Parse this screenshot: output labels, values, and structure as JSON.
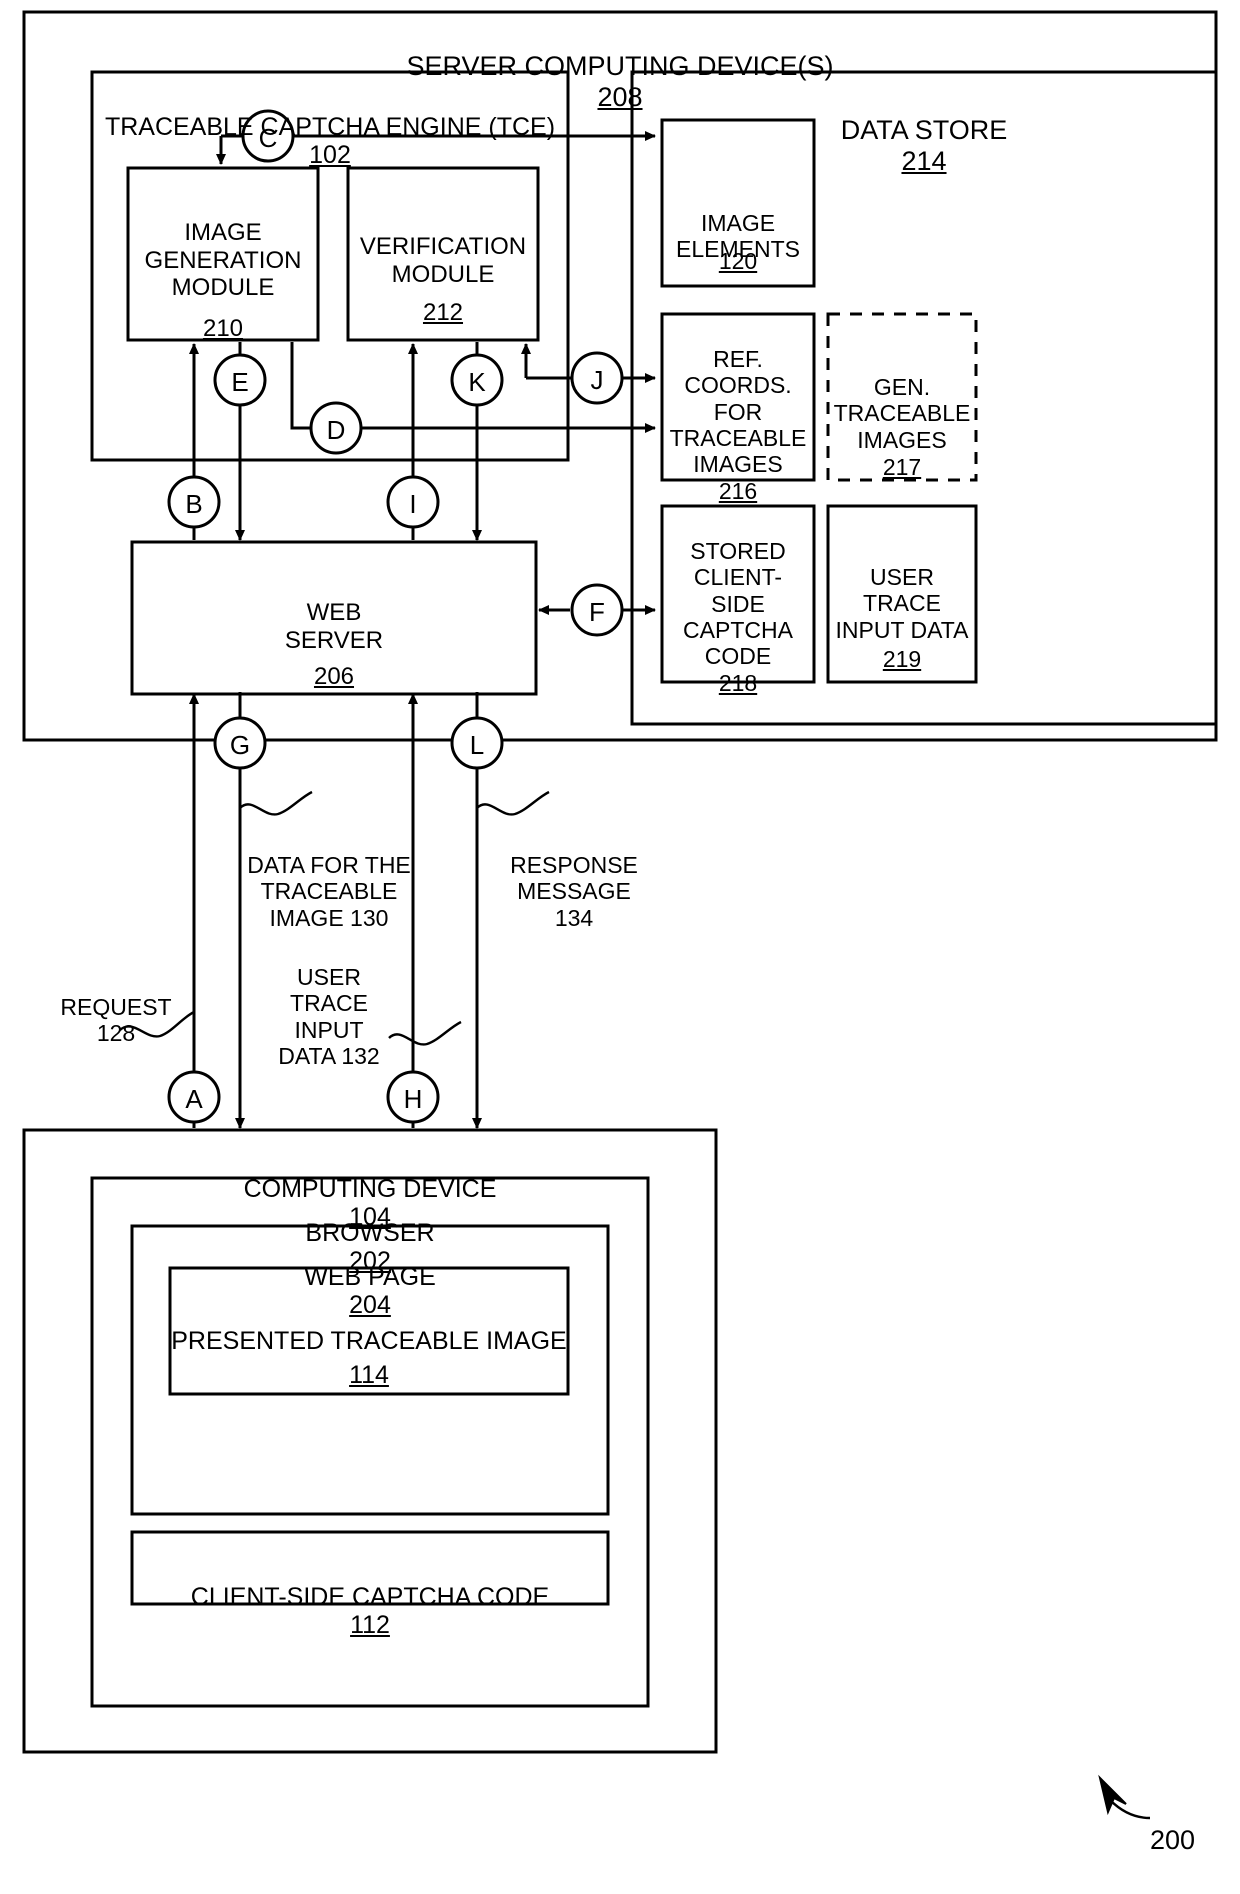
{
  "figure": {
    "number": "200",
    "title_top": "SERVER COMPUTING DEVICE(S)",
    "title_top_ref": "208"
  },
  "server": {
    "label": "SERVER COMPUTING DEVICE(S)",
    "ref": "208"
  },
  "tce": {
    "label": "TRACEABLE CAPTCHA ENGINE (TCE)",
    "ref": "102",
    "modules": [
      {
        "label": "IMAGE\nGENERATION\nMODULE",
        "ref": "210"
      },
      {
        "label": "VERIFICATION\nMODULE",
        "ref": "212"
      }
    ]
  },
  "data_store": {
    "label": "DATA STORE",
    "ref": "214",
    "items": [
      {
        "label": "IMAGE\nELEMENTS",
        "ref": "120",
        "dashed": false
      },
      {
        "label": "REF.\nCOORDS.\nFOR\nTRACEABLE\nIMAGES",
        "ref": "216",
        "dashed": false
      },
      {
        "label": "GEN.\nTRACEABLE\nIMAGES",
        "ref": "217",
        "dashed": true
      },
      {
        "label": "STORED\nCLIENT-\nSIDE\nCAPTCHA\nCODE",
        "ref": "218",
        "dashed": false
      },
      {
        "label": "USER\nTRACE\nINPUT DATA",
        "ref": "219",
        "dashed": false
      }
    ]
  },
  "web_server": {
    "label": "WEB\nSERVER",
    "ref": "206"
  },
  "computing_device": {
    "label": "COMPUTING DEVICE",
    "ref": "104",
    "browser": {
      "label": "BROWSER",
      "ref": "202",
      "web_page": {
        "label": "WEB PAGE",
        "ref": "204",
        "presented_image": {
          "label": "PRESENTED TRACEABLE IMAGE",
          "ref": "114"
        }
      },
      "client_code": {
        "label": "CLIENT-SIDE CAPTCHA CODE",
        "ref": "112"
      }
    }
  },
  "flow_labels": [
    {
      "name": "request",
      "text": "REQUEST\n128"
    },
    {
      "name": "data-for-traceable-image",
      "text": "DATA FOR THE\nTRACEABLE\nIMAGE 130"
    },
    {
      "name": "user-trace-input-data",
      "text": "USER\nTRACE\nINPUT\nDATA 132"
    },
    {
      "name": "response-message",
      "text": "RESPONSE\nMESSAGE\n134"
    }
  ],
  "connectors": [
    {
      "id": "A",
      "letter": "A"
    },
    {
      "id": "B",
      "letter": "B"
    },
    {
      "id": "C",
      "letter": "C"
    },
    {
      "id": "D",
      "letter": "D"
    },
    {
      "id": "E",
      "letter": "E"
    },
    {
      "id": "F",
      "letter": "F"
    },
    {
      "id": "G",
      "letter": "G"
    },
    {
      "id": "H",
      "letter": "H"
    },
    {
      "id": "I",
      "letter": "I"
    },
    {
      "id": "J",
      "letter": "J"
    },
    {
      "id": "K",
      "letter": "K"
    },
    {
      "id": "L",
      "letter": "L"
    }
  ],
  "colors": {
    "ink": "#000000",
    "paper": "#ffffff"
  }
}
